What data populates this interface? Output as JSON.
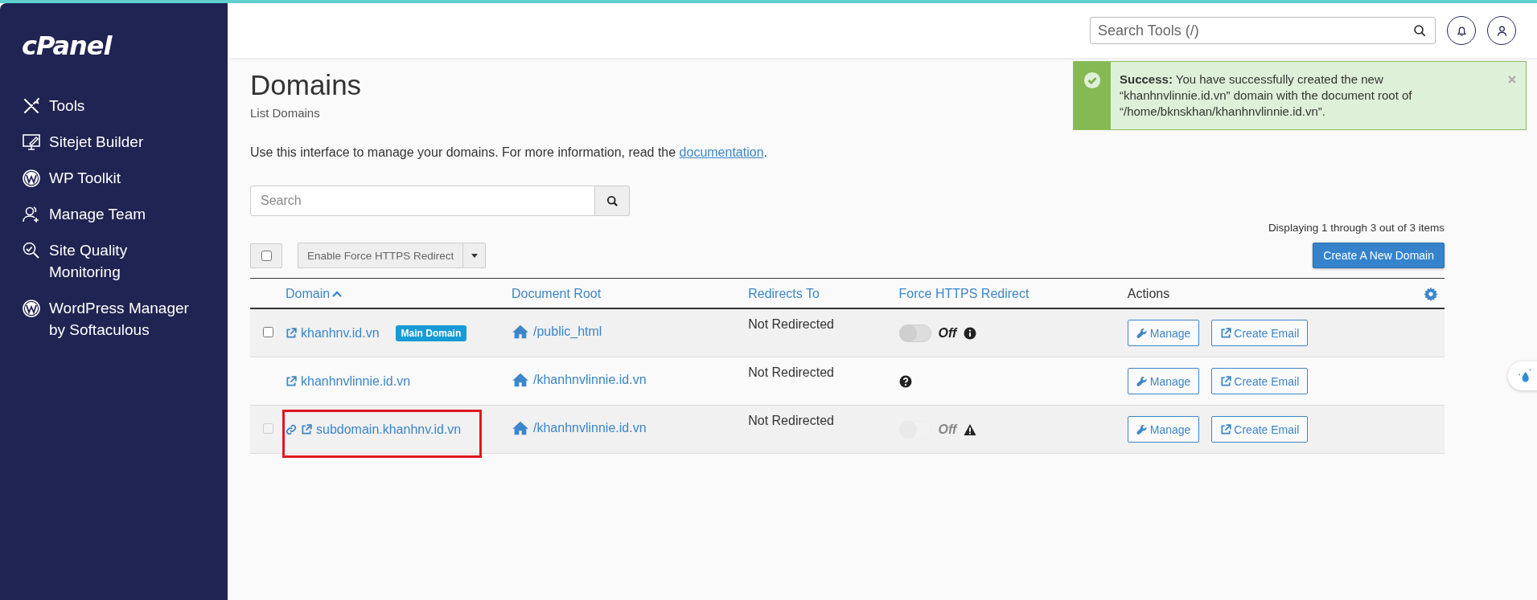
{
  "sidebar": {
    "logo": "cPanel",
    "items": [
      {
        "label": "Tools"
      },
      {
        "label": "Sitejet Builder"
      },
      {
        "label": "WP Toolkit"
      },
      {
        "label": "Manage Team"
      },
      {
        "label": "Site Quality Monitoring"
      },
      {
        "label": "WordPress Manager by Softaculous"
      }
    ]
  },
  "header": {
    "search": {
      "placeholder": "Search Tools (/)"
    }
  },
  "alert": {
    "kind": "success",
    "message": "**Success:** You have successfully created the new “khanhnvlinnie.id.vn” domain with the document root of “/home/bknskhan/khanhnvlinnie.id.vn”."
  },
  "page": {
    "title": "Domains",
    "subtitle": "List Domains",
    "intro": "Use this interface to manage your domains. For more information, read the ",
    "intro_link": "documentation",
    "intro_end": "."
  },
  "search": {
    "placeholder": "Search"
  },
  "paging": "Displaying 1 through 3 out of 3 items",
  "toolbar": {
    "select_all": {
      "checked": false
    },
    "bulk_action": "Enable Force HTTPS Redirect",
    "create_button": "Create A New Domain"
  },
  "table": {
    "columns": [
      {
        "label": "Domain",
        "kind": "link",
        "sorted": true
      },
      {
        "label": "Document Root",
        "kind": "link",
        "sorted": false
      },
      {
        "label": "Redirects To",
        "kind": "link",
        "sorted": false
      },
      {
        "label": "Force HTTPS Redirect",
        "kind": "link",
        "sorted": false
      },
      {
        "label": "Actions",
        "kind": "plain",
        "sorted": false
      }
    ],
    "rows": [
      {
        "select": {
          "checked": false,
          "disabled": false
        },
        "alias": false,
        "domain": "khanhnv.id.vn",
        "badge": "Main Domain",
        "document_root": "/public_html",
        "redirects_to": "Not Redirected",
        "https": {
          "label": "Off",
          "on": false,
          "disabled": false
        },
        "notice": {
          "kind": "info"
        },
        "highlighted": false,
        "actions": [
          {
            "kind": "manage",
            "label": "Manage"
          },
          {
            "kind": "email",
            "label": "Create Email"
          }
        ]
      },
      {
        "alias": false,
        "domain": "khanhnvlinnie.id.vn",
        "document_root": "/khanhnvlinnie.id.vn",
        "redirects_to": "Not Redirected",
        "notice": {
          "kind": "question"
        },
        "highlighted": false,
        "actions": [
          {
            "kind": "manage",
            "label": "Manage"
          },
          {
            "kind": "email",
            "label": "Create Email"
          }
        ]
      },
      {
        "select": {
          "checked": false,
          "disabled": true
        },
        "alias": true,
        "domain": "subdomain.khanhnv.id.vn",
        "document_root": "/khanhnvlinnie.id.vn",
        "redirects_to": "Not Redirected",
        "https": {
          "label": "Off",
          "on": false,
          "disabled": true
        },
        "notice": {
          "kind": "warning"
        },
        "highlighted": true,
        "actions": [
          {
            "kind": "manage",
            "label": "Manage"
          },
          {
            "kind": "email",
            "label": "Create Email"
          }
        ]
      }
    ]
  }
}
